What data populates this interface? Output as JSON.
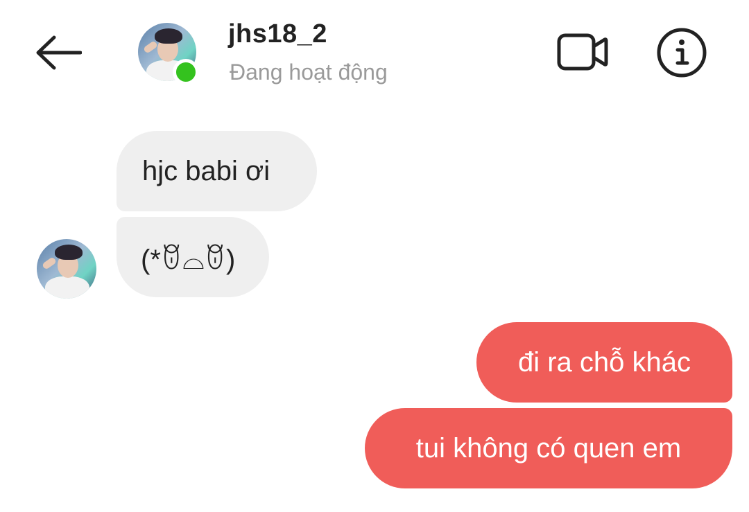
{
  "header": {
    "contact_name": "jhs18_2",
    "status": "Đang hoạt động",
    "back_icon": "arrow-left-icon",
    "video_icon": "video-call-icon",
    "info_icon": "info-icon",
    "online_color": "#34c21e"
  },
  "messages": [
    {
      "direction": "incoming",
      "text": "hjc babi ơi"
    },
    {
      "direction": "incoming",
      "text": "(*ꆤ⌓ꆤ)"
    },
    {
      "direction": "outgoing",
      "text": "đi ra chỗ khác"
    },
    {
      "direction": "outgoing",
      "text": "tui không có quen em"
    }
  ],
  "colors": {
    "incoming_bubble": "#efefef",
    "outgoing_bubble": "#f05d59",
    "status_text": "#9a9a9a"
  }
}
